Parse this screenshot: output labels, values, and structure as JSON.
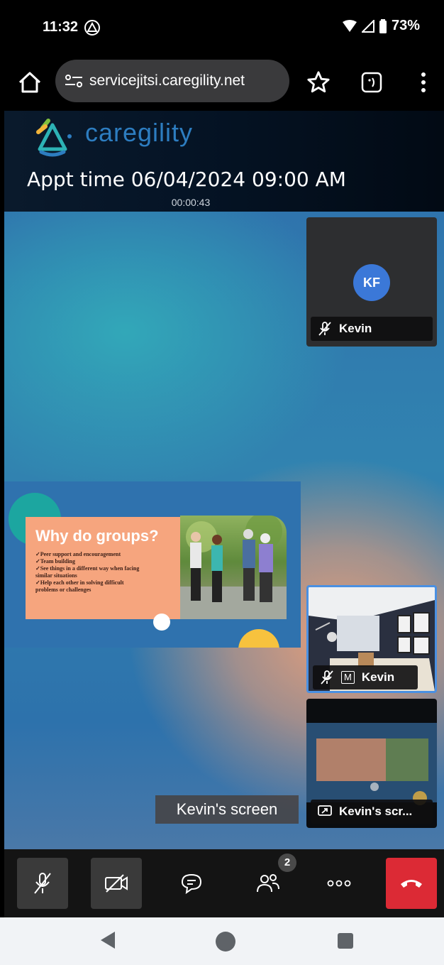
{
  "status_bar": {
    "time": "11:32",
    "battery": "73%",
    "icons": [
      "alert-triangle-icon",
      "wifi-icon",
      "cell-signal-icon",
      "battery-icon"
    ]
  },
  "browser": {
    "url": "servicejitsi.caregility.net",
    "icons": [
      "home-icon",
      "site-settings-icon",
      "star-icon",
      "tabs-icon",
      "overflow-menu-icon"
    ]
  },
  "meeting": {
    "brand": "caregility",
    "appt_time": "Appt time 06/04/2024 09:00 AM",
    "elapsed": "00:00:43"
  },
  "slide": {
    "title": "Why do groups?",
    "bullets": [
      "✓Peer support and encouragement",
      "✓Team building",
      "✓See things in a different way when facing",
      "  similar situations",
      "✓Help each other in solving difficult",
      "  problems or challenges"
    ],
    "screen_label": "Kevin's screen"
  },
  "thumbnails": [
    {
      "initials": "KF",
      "name": "Kevin",
      "icons": [
        "mic-muted-icon"
      ]
    },
    {
      "name": "Kevin",
      "moderator_badge": "M",
      "icons": [
        "mic-muted-icon",
        "moderator-icon"
      ],
      "active": true
    },
    {
      "name": "Kevin's scr...",
      "icons": [
        "screen-share-icon"
      ]
    }
  ],
  "toolbar": {
    "participants_count": "2",
    "buttons": [
      "mic-muted-icon",
      "camera-off-icon",
      "chat-icon",
      "participants-icon",
      "more-icon",
      "hangup-icon"
    ],
    "hangup_color": "#dc2a35"
  },
  "colors": {
    "brand_blue": "#2d7dc0",
    "active_border": "#4a90e2",
    "avatar_bg": "#3b78d8"
  }
}
